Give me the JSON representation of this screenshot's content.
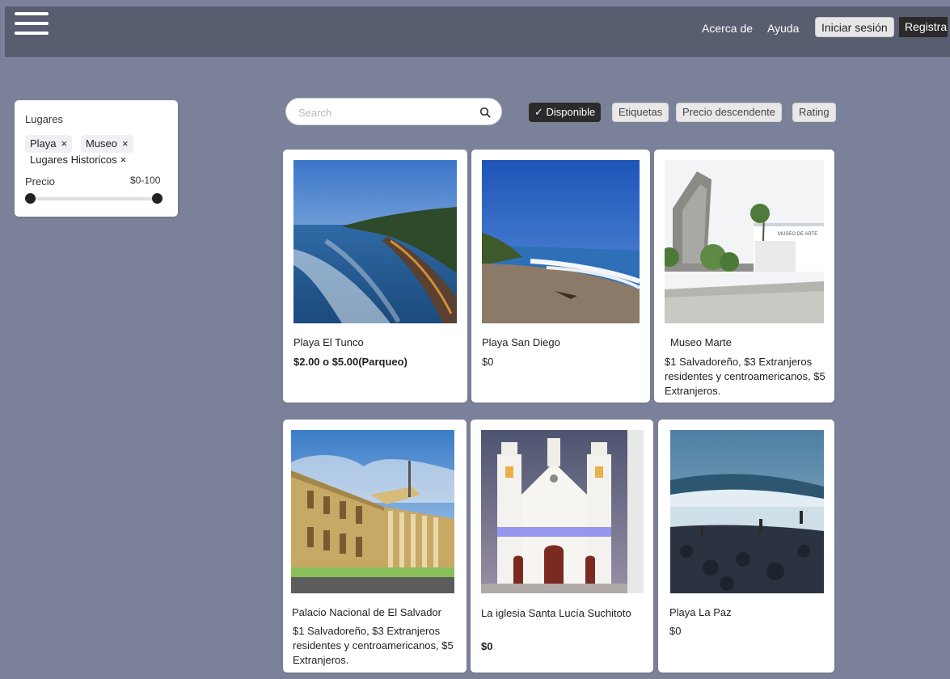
{
  "header": {
    "nav": {
      "about": "Acerca de",
      "help": "Ayuda"
    },
    "login_label": "Iniciar sesión",
    "register_label": "Registrarse"
  },
  "filters": {
    "title": "Lugares",
    "chips": [
      "Playa",
      "Museo",
      "Lugares Historicos"
    ],
    "chip_remove": "×",
    "price_label": "Precio",
    "price_range": "$0-100",
    "price_min": 0,
    "price_max": 100
  },
  "search": {
    "placeholder": "Search",
    "value": ""
  },
  "toolbar": {
    "available": "Disponible",
    "check": "✓",
    "tags": "Etiquetas",
    "sort": "Precio descendente",
    "rating": "Rating"
  },
  "places": [
    {
      "name": "Playa El Tunco",
      "price": "$2.00 o $5.00(Parqueo)"
    },
    {
      "name": "Playa San Diego",
      "price": "$0"
    },
    {
      "name": "Museo Marte",
      "price": "$1 Salvadoreño, $3 Extranjeros residentes y centroamericanos, $5 Extranjeros."
    },
    {
      "name": "Palacio Nacional de El Salvador",
      "price": "$1 Salvadoreño, $3 Extranjeros residentes y centroamericanos, $5 Extranjeros."
    },
    {
      "name": "La iglesia Santa Lucía Suchitoto",
      "price": "$0"
    },
    {
      "name": "Playa La Paz",
      "price": "$0"
    }
  ],
  "museum_sign": "MUSEO DE ARTE"
}
